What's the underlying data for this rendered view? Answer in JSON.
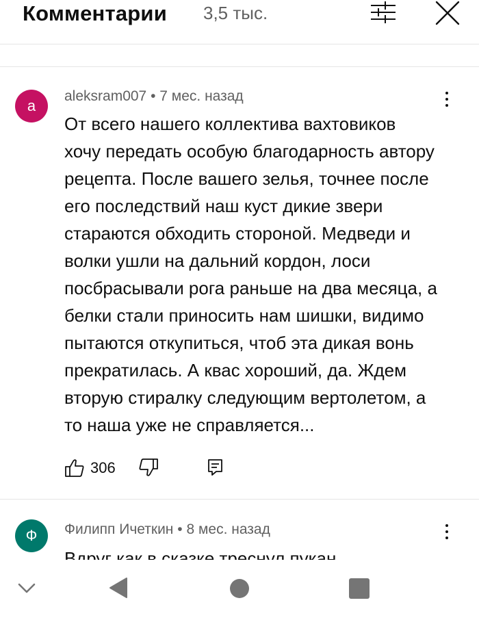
{
  "header": {
    "title": "Комментарии",
    "count": "3,5 тыс.",
    "filter_icon": "sliders-icon",
    "close_icon": "close-icon"
  },
  "comments": [
    {
      "avatar_letter": "a",
      "avatar_color": "#c51162",
      "author": "aleksram007",
      "separator": "•",
      "time": "7 мес. назад",
      "lines": [
        "От всего нашего коллектива вахтовиков",
        "хочу передать особую благодарность автору",
        "рецепта. После вашего зелья, точнее после",
        "его последствий наш куст дикие звери",
        "стараются обходить стороной. Медведи и",
        "волки ушли на дальний кордон, лоси",
        "посбрасывали рога раньше на два месяца, а",
        "белки стали приносить нам шишки, видимо",
        "пытаются откупиться, чтоб эта дикая вонь",
        "прекратилась. А квас хороший, да. Ждем",
        "вторую стиралку следующим вертолетом, а",
        "то наша уже не справляется..."
      ],
      "likes": "306"
    },
    {
      "avatar_letter": "Ф",
      "avatar_color": "#00796b",
      "author": "Филипп Ичеткин",
      "separator": "•",
      "time": "8 мес. назад",
      "lines": [
        "Вдруг как в сказке треснул пукан"
      ]
    }
  ],
  "colors": {
    "text": "#0f0f0f",
    "secondary": "#606060",
    "divider": "#e5e5e5",
    "nav_icon": "#757575"
  },
  "navbar": {
    "down_icon": "chevron-down-icon",
    "back_icon": "back-triangle-icon",
    "home_icon": "home-circle-icon",
    "recents_icon": "recents-square-icon"
  }
}
